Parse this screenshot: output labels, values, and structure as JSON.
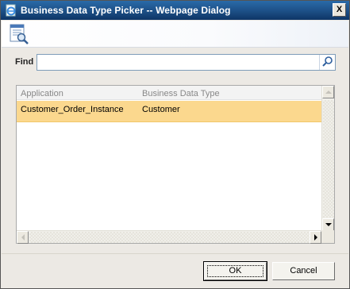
{
  "window": {
    "title": "Business Data Type Picker -- Webpage Dialog",
    "close_label": "X"
  },
  "find": {
    "label": "Find",
    "value": "",
    "placeholder": ""
  },
  "grid": {
    "columns": [
      "Application",
      "Business Data Type"
    ],
    "rows": [
      {
        "application": "Customer_Order_Instance",
        "type": "Customer",
        "selected": true
      }
    ]
  },
  "buttons": {
    "ok": "OK",
    "cancel": "Cancel"
  },
  "colors": {
    "selected_row": "#fbd88e",
    "titlebar": "#1c4f86"
  },
  "icons": {
    "app": "ie-page-icon",
    "toolbar": "document-search-icon",
    "search": "search-icon"
  }
}
